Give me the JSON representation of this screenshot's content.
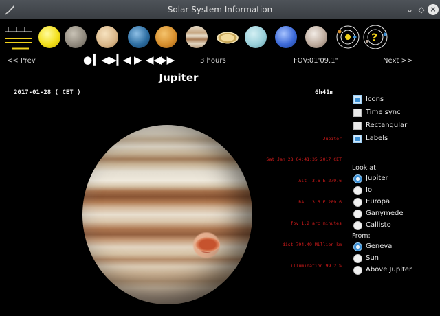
{
  "window": {
    "title": "Solar System Information"
  },
  "toolbar": {
    "bodies": [
      "Sun",
      "Mercury",
      "Venus",
      "Earth",
      "Mars",
      "Jupiter",
      "Saturn",
      "Uranus",
      "Neptune",
      "Pluto"
    ]
  },
  "nav": {
    "prev": "<< Prev",
    "next": "Next >>",
    "timestep": "3 hours",
    "fov": "FOV:01'09.1\""
  },
  "view": {
    "title": "Jupiter",
    "date": "2017-01-28  ( CET )",
    "hour_angle": "6h41m"
  },
  "info_lines": [
    "Jupiter",
    "Sat Jan 28 04:41:35 2017 CET",
    "Alt  3.6 E 279.6",
    "RA   3.6 E 289.6",
    "fov 1.2 arc minutes",
    "dist 794.49 Million km",
    "illumination 99.2 %"
  ],
  "options": {
    "icons": {
      "label": "Icons",
      "checked": true
    },
    "time_sync": {
      "label": "Time sync",
      "checked": false
    },
    "rectangular": {
      "label": "Rectangular",
      "checked": false
    },
    "labels": {
      "label": "Labels",
      "checked": true
    }
  },
  "look_at": {
    "heading": "Look at:",
    "items": [
      "Jupiter",
      "Io",
      "Europa",
      "Ganymede",
      "Callisto"
    ],
    "selected": "Jupiter"
  },
  "from": {
    "heading": "From:",
    "items": [
      "Geneva",
      "Sun",
      "Above Jupiter"
    ],
    "selected": "Geneva"
  },
  "colors": {
    "accent": "#3b8fd4",
    "info_text": "#d41b1b",
    "background": "#000000"
  }
}
